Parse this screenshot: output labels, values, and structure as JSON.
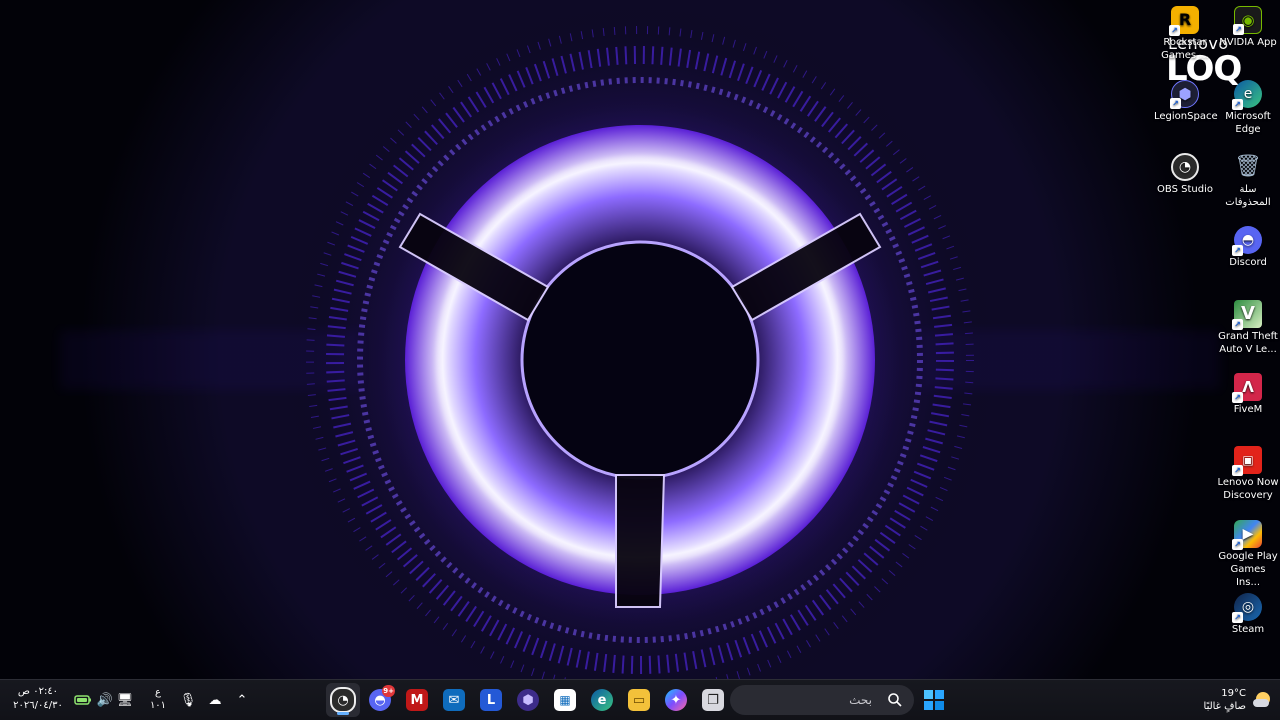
{
  "brand": {
    "company": "Lenovo",
    "product": "LOQ"
  },
  "desktop": {
    "icons": [
      {
        "label": "Rockstar Games ...",
        "icon": "rockstar-games-icon",
        "color": "#f4b000"
      },
      {
        "label": "NVIDIA App",
        "icon": "nvidia-app-icon",
        "color": "#76b900"
      },
      {
        "label": "LegionSpace",
        "icon": "legionspace-icon",
        "color": "#6f76ff"
      },
      {
        "label": "Microsoft Edge",
        "icon": "microsoft-edge-icon",
        "color": "#2ea3f2"
      },
      {
        "label": "OBS Studio",
        "icon": "obs-studio-icon",
        "color": "#ffffff"
      },
      {
        "label": "سلة المحذوفات",
        "icon": "recycle-bin-icon",
        "color": "#9fb3c8"
      },
      {
        "label": "Discord",
        "icon": "discord-icon",
        "color": "#5865f2"
      },
      {
        "label": "Grand Theft Auto V Le...",
        "icon": "gta-v-icon",
        "color": "#4fa83d"
      },
      {
        "label": "FiveM",
        "icon": "fivem-icon",
        "color": "#d3264a"
      },
      {
        "label": "Lenovo Now Discovery",
        "icon": "lenovo-now-discovery-icon",
        "color": "#e2231a"
      },
      {
        "label": "Google Play Games Ins...",
        "icon": "google-play-games-icon",
        "color": "#34a853"
      },
      {
        "label": "Steam",
        "icon": "steam-icon",
        "color": "#1b2838"
      }
    ]
  },
  "taskbar": {
    "start_label": "Start",
    "search_placeholder": "بحث",
    "search_decoration": "🌷🌷🌷",
    "apps": [
      {
        "name": "OBS Studio",
        "icon": "obs-studio-icon",
        "active": true
      },
      {
        "name": "Discord",
        "icon": "discord-icon",
        "badge": "9+"
      },
      {
        "name": "McAfee",
        "icon": "mcafee-icon"
      },
      {
        "name": "Outlook",
        "icon": "outlook-icon"
      },
      {
        "name": "Lenovo Vantage",
        "icon": "lenovo-vantage-icon",
        "letter": "L"
      },
      {
        "name": "LegionSpace",
        "icon": "legionspace-icon"
      },
      {
        "name": "Microsoft Store",
        "icon": "microsoft-store-icon"
      },
      {
        "name": "Microsoft Edge",
        "icon": "microsoft-edge-icon"
      },
      {
        "name": "File Explorer",
        "icon": "file-explorer-icon"
      },
      {
        "name": "Copilot",
        "icon": "copilot-icon"
      },
      {
        "name": "Task View",
        "icon": "task-view-icon"
      }
    ],
    "tray": {
      "time": "٠٢:٤٠ ص",
      "date": "٢٠٢٦/٠٤/٣٠",
      "language_top": "ع",
      "language_bottom": "١٠١",
      "weather_temp": "19°C",
      "weather_desc": "صافٍ غالبًا",
      "notification_count": "1"
    }
  }
}
